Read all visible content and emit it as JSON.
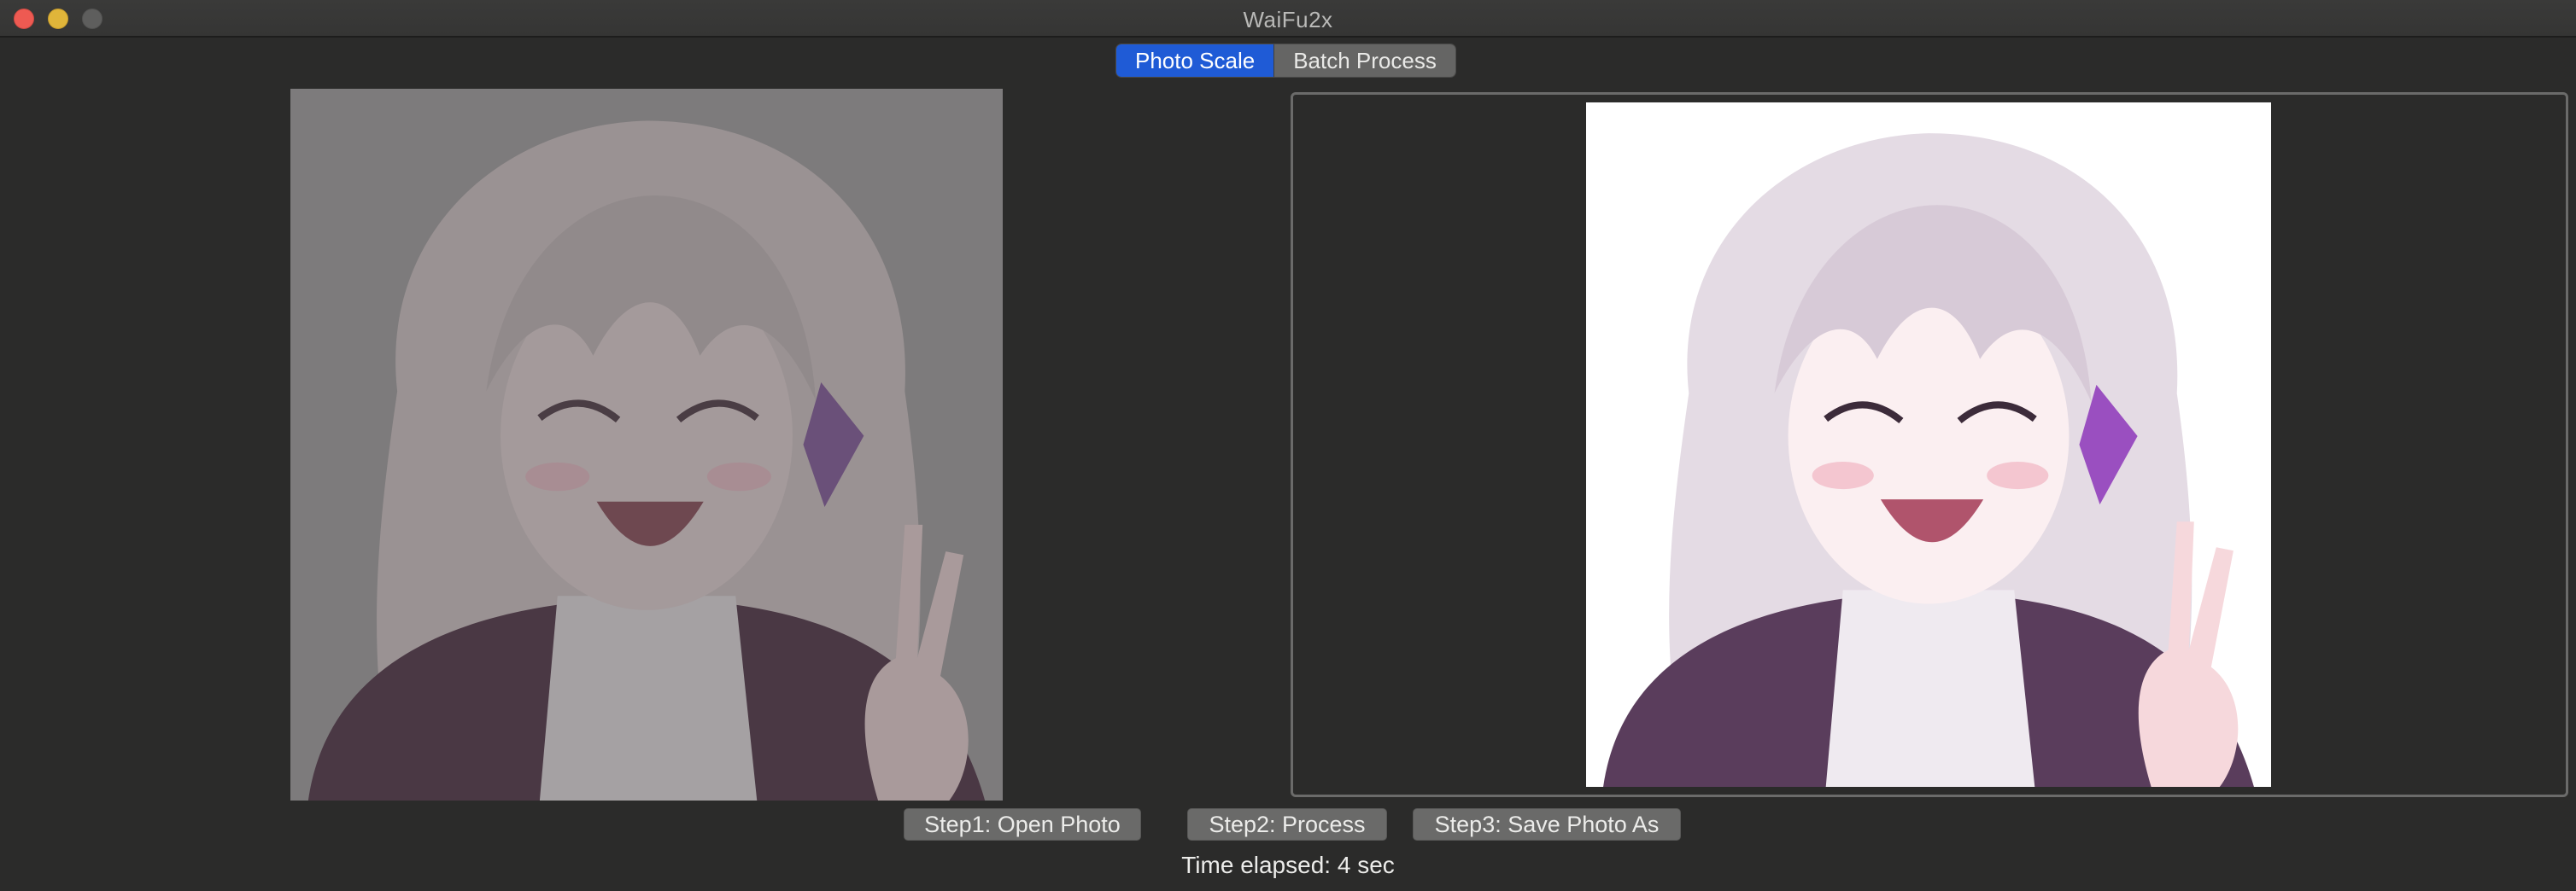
{
  "window": {
    "title": "WaiFu2x"
  },
  "tabs": [
    {
      "label": "Photo Scale",
      "selected": true
    },
    {
      "label": "Batch Process",
      "selected": false
    }
  ],
  "panes": {
    "original": {
      "image": "anime-girl-original-dim"
    },
    "upscaled": {
      "image": "anime-girl-upscaled"
    }
  },
  "buttons": {
    "open": "Step1: Open Photo",
    "process": "Step2: Process",
    "save": "Step3: Save Photo As"
  },
  "status": {
    "elapsed": "Time elapsed: 4 sec"
  },
  "colors": {
    "background": "#2b2b2a",
    "tab_active": "#1f5bd6",
    "button": "#6a6a69"
  }
}
